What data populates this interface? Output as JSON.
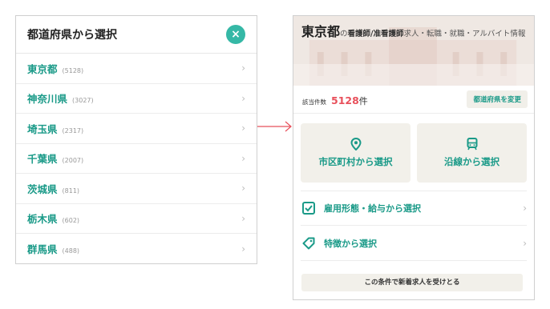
{
  "left_panel": {
    "title": "都道府県から選択",
    "close_icon": "×",
    "prefectures": [
      {
        "name": "東京都",
        "count": "(5128)"
      },
      {
        "name": "神奈川県",
        "count": "(3027)"
      },
      {
        "name": "埼玉県",
        "count": "(2317)"
      },
      {
        "name": "千葉県",
        "count": "(2007)"
      },
      {
        "name": "茨城県",
        "count": "(811)"
      },
      {
        "name": "栃木県",
        "count": "(602)"
      },
      {
        "name": "群馬県",
        "count": "(488)"
      }
    ]
  },
  "right_panel": {
    "hero": {
      "prefecture": "東京都",
      "particle": "の",
      "job": "看護師/准看護師",
      "rest": "求人・転職・就職・アルバイト情報"
    },
    "count_label": "該当件数",
    "count_value": "5128",
    "count_unit": "件",
    "change_button": "都道府県を変更",
    "big_buttons": [
      {
        "label": "市区町村から選択",
        "icon": "map-pin-icon"
      },
      {
        "label": "沿線から選択",
        "icon": "train-icon"
      }
    ],
    "menu": [
      {
        "label": "雇用形態・給与から選択",
        "icon": "checkbox-icon"
      },
      {
        "label": "特徴から選択",
        "icon": "tag-icon"
      }
    ],
    "notify_button": "この条件で新着求人を受けとる"
  },
  "colors": {
    "accent": "#1a9a88",
    "close_bg": "#35b8a6",
    "count": "#e8505b",
    "arrow": "#e8505b",
    "button_bg": "#f2f0ea"
  }
}
